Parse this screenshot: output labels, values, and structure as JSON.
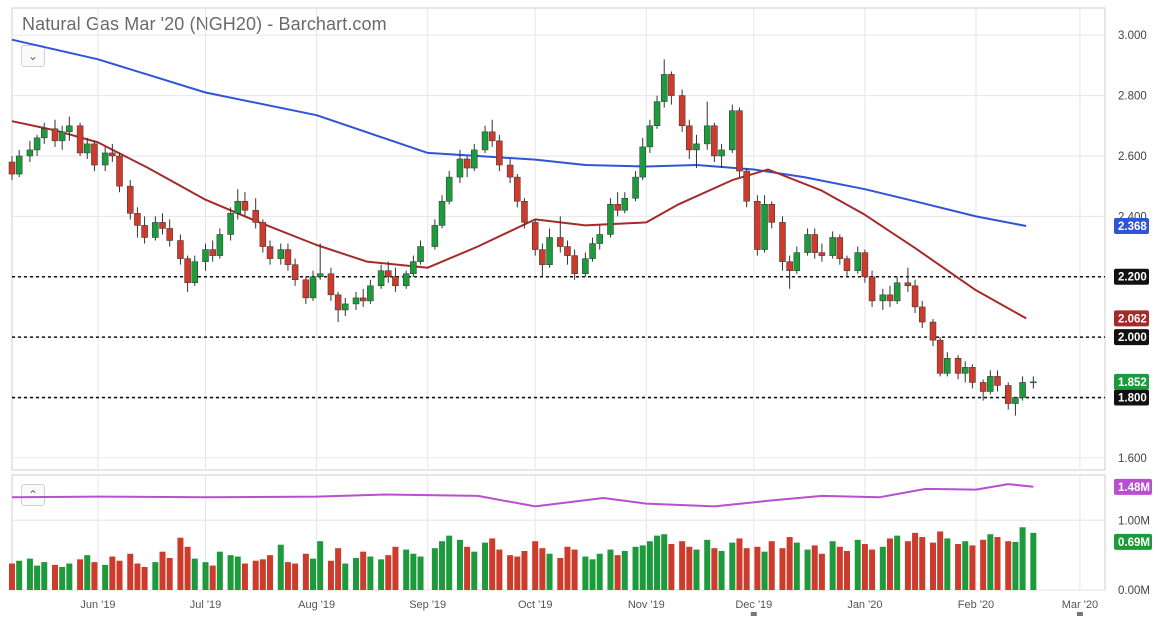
{
  "header": {
    "title": "Natural Gas Mar '20 (NGH20) - Barchart.com",
    "collapse_top_label": "⌄",
    "collapse_volume_label": "⌃"
  },
  "colors": {
    "up": "#1d9a3c",
    "down": "#cc3b2b",
    "ma_long": "#2f54d8",
    "ma_short": "#a52a2a",
    "volume_ma": "#b94fd0",
    "grid": "#e6e6e6",
    "neutral_bar": "#3450c0"
  },
  "chart_data": {
    "type": "candlestick",
    "x_axis": {
      "tick_labels": [
        "Jun '19",
        "Jul '19",
        "Aug '19",
        "Sep '19",
        "Oct '19",
        "Nov '19",
        "Dec '19",
        "Jan '20",
        "Feb '20",
        "Mar '20"
      ],
      "range": [
        "2019-05-08",
        "2020-03-08"
      ]
    },
    "price_axis": {
      "ylim": [
        1.56,
        3.09
      ],
      "tick_labels": [
        "3.000",
        "2.800",
        "2.600",
        "2.400",
        "2.200",
        "2.000",
        "1.800",
        "1.600"
      ],
      "tick_values": [
        3.0,
        2.8,
        2.6,
        2.4,
        2.2,
        2.0,
        1.8,
        1.6
      ]
    },
    "horizontal_lines": [
      {
        "value": 2.2,
        "label": "2.200"
      },
      {
        "value": 2.0,
        "label": "2.000"
      },
      {
        "value": 1.8,
        "label": "1.800"
      }
    ],
    "last_value_badges": [
      {
        "label": "2.368",
        "value": 2.368,
        "series": "ma_long"
      },
      {
        "label": "2.062",
        "value": 2.062,
        "series": "ma_short"
      },
      {
        "label": "1.852",
        "value": 1.852,
        "series": "price"
      }
    ],
    "ma_long": {
      "dates": [
        "2019-05-08",
        "2019-06-01",
        "2019-07-01",
        "2019-08-01",
        "2019-09-01",
        "2019-09-15",
        "2019-10-01",
        "2019-10-15",
        "2019-11-01",
        "2019-11-15",
        "2019-12-01",
        "2019-12-15",
        "2020-01-01",
        "2020-01-15",
        "2020-02-01",
        "2020-02-15"
      ],
      "values": [
        2.985,
        2.92,
        2.81,
        2.735,
        2.61,
        2.6,
        2.588,
        2.57,
        2.565,
        2.57,
        2.555,
        2.53,
        2.49,
        2.45,
        2.4,
        2.368
      ]
    },
    "ma_short": {
      "dates": [
        "2019-05-08",
        "2019-05-20",
        "2019-06-01",
        "2019-06-15",
        "2019-07-01",
        "2019-07-15",
        "2019-08-01",
        "2019-08-15",
        "2019-09-01",
        "2019-09-15",
        "2019-10-01",
        "2019-10-15",
        "2019-11-01",
        "2019-11-10",
        "2019-11-25",
        "2019-12-05",
        "2019-12-20",
        "2020-01-01",
        "2020-01-15",
        "2020-02-01",
        "2020-02-15"
      ],
      "values": [
        2.715,
        2.685,
        2.645,
        2.56,
        2.455,
        2.385,
        2.305,
        2.25,
        2.23,
        2.3,
        2.39,
        2.37,
        2.38,
        2.44,
        2.52,
        2.555,
        2.485,
        2.405,
        2.295,
        2.155,
        2.062
      ]
    },
    "ohlc": [
      [
        "2019-05-08",
        2.58,
        2.6,
        2.52,
        2.54
      ],
      [
        "2019-05-10",
        2.54,
        2.62,
        2.53,
        2.6
      ],
      [
        "2019-05-13",
        2.6,
        2.65,
        2.58,
        2.62
      ],
      [
        "2019-05-15",
        2.62,
        2.67,
        2.6,
        2.66
      ],
      [
        "2019-05-17",
        2.66,
        2.71,
        2.64,
        2.69
      ],
      [
        "2019-05-20",
        2.69,
        2.72,
        2.63,
        2.65
      ],
      [
        "2019-05-22",
        2.65,
        2.7,
        2.62,
        2.68
      ],
      [
        "2019-05-24",
        2.68,
        2.73,
        2.65,
        2.7
      ],
      [
        "2019-05-27",
        2.7,
        2.71,
        2.6,
        2.61
      ],
      [
        "2019-05-29",
        2.61,
        2.66,
        2.59,
        2.64
      ],
      [
        "2019-05-31",
        2.64,
        2.65,
        2.55,
        2.57
      ],
      [
        "2019-06-03",
        2.57,
        2.63,
        2.55,
        2.61
      ],
      [
        "2019-06-05",
        2.61,
        2.64,
        2.58,
        2.6
      ],
      [
        "2019-06-07",
        2.6,
        2.61,
        2.48,
        2.5
      ],
      [
        "2019-06-10",
        2.5,
        2.52,
        2.39,
        2.41
      ],
      [
        "2019-06-12",
        2.41,
        2.43,
        2.33,
        2.37
      ],
      [
        "2019-06-14",
        2.37,
        2.4,
        2.31,
        2.33
      ],
      [
        "2019-06-17",
        2.33,
        2.4,
        2.32,
        2.38
      ],
      [
        "2019-06-19",
        2.38,
        2.41,
        2.34,
        2.36
      ],
      [
        "2019-06-21",
        2.36,
        2.39,
        2.3,
        2.32
      ],
      [
        "2019-06-24",
        2.32,
        2.34,
        2.24,
        2.26
      ],
      [
        "2019-06-26",
        2.26,
        2.27,
        2.15,
        2.18
      ],
      [
        "2019-06-28",
        2.18,
        2.27,
        2.17,
        2.25
      ],
      [
        "2019-07-01",
        2.25,
        2.31,
        2.22,
        2.29
      ],
      [
        "2019-07-03",
        2.29,
        2.32,
        2.25,
        2.27
      ],
      [
        "2019-07-05",
        2.27,
        2.36,
        2.26,
        2.34
      ],
      [
        "2019-07-08",
        2.34,
        2.43,
        2.32,
        2.41
      ],
      [
        "2019-07-10",
        2.41,
        2.49,
        2.39,
        2.45
      ],
      [
        "2019-07-12",
        2.45,
        2.48,
        2.4,
        2.42
      ],
      [
        "2019-07-15",
        2.42,
        2.46,
        2.36,
        2.38
      ],
      [
        "2019-07-17",
        2.38,
        2.39,
        2.28,
        2.3
      ],
      [
        "2019-07-19",
        2.3,
        2.32,
        2.24,
        2.26
      ],
      [
        "2019-07-22",
        2.26,
        2.31,
        2.24,
        2.29
      ],
      [
        "2019-07-24",
        2.29,
        2.31,
        2.22,
        2.24
      ],
      [
        "2019-07-26",
        2.24,
        2.26,
        2.17,
        2.19
      ],
      [
        "2019-07-29",
        2.19,
        2.2,
        2.11,
        2.13
      ],
      [
        "2019-07-31",
        2.13,
        2.22,
        2.12,
        2.2
      ],
      [
        "2019-08-02",
        2.2,
        2.31,
        2.19,
        2.21
      ],
      [
        "2019-08-05",
        2.21,
        2.23,
        2.12,
        2.14
      ],
      [
        "2019-08-07",
        2.14,
        2.15,
        2.05,
        2.09
      ],
      [
        "2019-08-09",
        2.09,
        2.13,
        2.07,
        2.11
      ],
      [
        "2019-08-12",
        2.11,
        2.15,
        2.09,
        2.13
      ],
      [
        "2019-08-14",
        2.13,
        2.16,
        2.1,
        2.12
      ],
      [
        "2019-08-16",
        2.12,
        2.19,
        2.11,
        2.17
      ],
      [
        "2019-08-19",
        2.17,
        2.24,
        2.16,
        2.22
      ],
      [
        "2019-08-21",
        2.22,
        2.25,
        2.18,
        2.2
      ],
      [
        "2019-08-23",
        2.2,
        2.23,
        2.15,
        2.17
      ],
      [
        "2019-08-26",
        2.17,
        2.22,
        2.16,
        2.21
      ],
      [
        "2019-08-28",
        2.21,
        2.27,
        2.2,
        2.25
      ],
      [
        "2019-08-30",
        2.25,
        2.32,
        2.24,
        2.3
      ],
      [
        "2019-09-03",
        2.3,
        2.39,
        2.29,
        2.37
      ],
      [
        "2019-09-05",
        2.37,
        2.47,
        2.36,
        2.45
      ],
      [
        "2019-09-07",
        2.45,
        2.55,
        2.44,
        2.53
      ],
      [
        "2019-09-10",
        2.53,
        2.62,
        2.51,
        2.59
      ],
      [
        "2019-09-12",
        2.59,
        2.6,
        2.53,
        2.56
      ],
      [
        "2019-09-14",
        2.56,
        2.64,
        2.55,
        2.62
      ],
      [
        "2019-09-17",
        2.62,
        2.7,
        2.61,
        2.68
      ],
      [
        "2019-09-19",
        2.68,
        2.72,
        2.63,
        2.65
      ],
      [
        "2019-09-21",
        2.65,
        2.67,
        2.55,
        2.57
      ],
      [
        "2019-09-24",
        2.57,
        2.59,
        2.51,
        2.53
      ],
      [
        "2019-09-26",
        2.53,
        2.54,
        2.43,
        2.45
      ],
      [
        "2019-09-28",
        2.45,
        2.46,
        2.36,
        2.38
      ],
      [
        "2019-10-01",
        2.38,
        2.39,
        2.27,
        2.29
      ],
      [
        "2019-10-03",
        2.29,
        2.31,
        2.2,
        2.24
      ],
      [
        "2019-10-05",
        2.24,
        2.36,
        2.23,
        2.33
      ],
      [
        "2019-10-08",
        2.33,
        2.4,
        2.28,
        2.3
      ],
      [
        "2019-10-10",
        2.3,
        2.32,
        2.24,
        2.27
      ],
      [
        "2019-10-12",
        2.27,
        2.29,
        2.19,
        2.21
      ],
      [
        "2019-10-15",
        2.21,
        2.28,
        2.2,
        2.26
      ],
      [
        "2019-10-17",
        2.26,
        2.33,
        2.25,
        2.31
      ],
      [
        "2019-10-19",
        2.31,
        2.37,
        2.29,
        2.34
      ],
      [
        "2019-10-22",
        2.34,
        2.46,
        2.33,
        2.44
      ],
      [
        "2019-10-24",
        2.44,
        2.48,
        2.4,
        2.42
      ],
      [
        "2019-10-26",
        2.42,
        2.48,
        2.41,
        2.46
      ],
      [
        "2019-10-29",
        2.46,
        2.55,
        2.45,
        2.53
      ],
      [
        "2019-10-31",
        2.53,
        2.66,
        2.52,
        2.63
      ],
      [
        "2019-11-02",
        2.63,
        2.72,
        2.61,
        2.7
      ],
      [
        "2019-11-04",
        2.7,
        2.8,
        2.69,
        2.78
      ],
      [
        "2019-11-06",
        2.78,
        2.92,
        2.76,
        2.87
      ],
      [
        "2019-11-08",
        2.87,
        2.88,
        2.77,
        2.8
      ],
      [
        "2019-11-11",
        2.8,
        2.82,
        2.68,
        2.7
      ],
      [
        "2019-11-13",
        2.7,
        2.72,
        2.59,
        2.62
      ],
      [
        "2019-11-15",
        2.62,
        2.67,
        2.56,
        2.64
      ],
      [
        "2019-11-18",
        2.64,
        2.78,
        2.62,
        2.7
      ],
      [
        "2019-11-20",
        2.7,
        2.71,
        2.58,
        2.6
      ],
      [
        "2019-11-22",
        2.6,
        2.64,
        2.56,
        2.62
      ],
      [
        "2019-11-25",
        2.62,
        2.77,
        2.61,
        2.75
      ],
      [
        "2019-11-27",
        2.75,
        2.76,
        2.53,
        2.55
      ],
      [
        "2019-11-29",
        2.55,
        2.56,
        2.43,
        2.45
      ],
      [
        "2019-12-02",
        2.45,
        2.47,
        2.27,
        2.29
      ],
      [
        "2019-12-04",
        2.29,
        2.47,
        2.28,
        2.44
      ],
      [
        "2019-12-06",
        2.44,
        2.45,
        2.36,
        2.38
      ],
      [
        "2019-12-09",
        2.38,
        2.4,
        2.22,
        2.25
      ],
      [
        "2019-12-11",
        2.25,
        2.27,
        2.16,
        2.22
      ],
      [
        "2019-12-13",
        2.22,
        2.3,
        2.21,
        2.28
      ],
      [
        "2019-12-16",
        2.28,
        2.36,
        2.27,
        2.34
      ],
      [
        "2019-12-18",
        2.34,
        2.36,
        2.26,
        2.28
      ],
      [
        "2019-12-20",
        2.28,
        2.31,
        2.25,
        2.27
      ],
      [
        "2019-12-23",
        2.27,
        2.35,
        2.26,
        2.33
      ],
      [
        "2019-12-25",
        2.33,
        2.34,
        2.24,
        2.26
      ],
      [
        "2019-12-27",
        2.26,
        2.27,
        2.2,
        2.22
      ],
      [
        "2019-12-30",
        2.22,
        2.3,
        2.21,
        2.28
      ],
      [
        "2020-01-01",
        2.28,
        2.29,
        2.18,
        2.2
      ],
      [
        "2020-01-03",
        2.2,
        2.22,
        2.1,
        2.12
      ],
      [
        "2020-01-06",
        2.12,
        2.16,
        2.09,
        2.14
      ],
      [
        "2020-01-08",
        2.14,
        2.17,
        2.1,
        2.12
      ],
      [
        "2020-01-10",
        2.12,
        2.2,
        2.11,
        2.18
      ],
      [
        "2020-01-13",
        2.18,
        2.23,
        2.15,
        2.17
      ],
      [
        "2020-01-15",
        2.17,
        2.19,
        2.08,
        2.1
      ],
      [
        "2020-01-17",
        2.1,
        2.12,
        2.03,
        2.05
      ],
      [
        "2020-01-20",
        2.05,
        2.06,
        1.97,
        1.99
      ],
      [
        "2020-01-22",
        1.99,
        2.0,
        1.87,
        1.88
      ],
      [
        "2020-01-24",
        1.88,
        1.95,
        1.87,
        1.93
      ],
      [
        "2020-01-27",
        1.93,
        1.94,
        1.86,
        1.88
      ],
      [
        "2020-01-29",
        1.88,
        1.92,
        1.85,
        1.9
      ],
      [
        "2020-01-31",
        1.9,
        1.91,
        1.83,
        1.85
      ],
      [
        "2020-02-03",
        1.85,
        1.86,
        1.79,
        1.82
      ],
      [
        "2020-02-05",
        1.82,
        1.89,
        1.81,
        1.87
      ],
      [
        "2020-02-07",
        1.87,
        1.89,
        1.82,
        1.84
      ],
      [
        "2020-02-10",
        1.84,
        1.85,
        1.76,
        1.78
      ],
      [
        "2020-02-12",
        1.78,
        1.8,
        1.74,
        1.8
      ],
      [
        "2020-02-14",
        1.8,
        1.87,
        1.79,
        1.85
      ],
      [
        "2020-02-17",
        1.85,
        1.87,
        1.83,
        1.852
      ]
    ],
    "volume_axis": {
      "tick_labels": [
        "1.00M",
        "0.00M"
      ],
      "tick_values": [
        1.0,
        0.0
      ],
      "ylim": [
        0,
        1.65
      ]
    },
    "volume_badges": [
      {
        "label": "1.48M",
        "value": 1.48,
        "series": "volume_ma"
      },
      {
        "label": "0.69M",
        "value": 0.69,
        "series": "volume"
      }
    ],
    "volume_ma": {
      "dates": [
        "2019-05-08",
        "2019-06-01",
        "2019-07-01",
        "2019-08-01",
        "2019-08-20",
        "2019-09-15",
        "2019-10-01",
        "2019-10-20",
        "2019-11-01",
        "2019-11-20",
        "2019-12-05",
        "2019-12-20",
        "2020-01-05",
        "2020-01-18",
        "2020-02-01",
        "2020-02-10",
        "2020-02-17"
      ],
      "values": [
        1.33,
        1.34,
        1.33,
        1.34,
        1.37,
        1.35,
        1.2,
        1.32,
        1.24,
        1.2,
        1.28,
        1.35,
        1.33,
        1.45,
        1.44,
        1.52,
        1.48
      ]
    },
    "volume": [
      0.38,
      0.42,
      0.45,
      0.35,
      0.4,
      0.36,
      0.33,
      0.38,
      0.44,
      0.5,
      0.4,
      0.36,
      0.48,
      0.42,
      0.52,
      0.38,
      0.33,
      0.4,
      0.55,
      0.46,
      0.75,
      0.62,
      0.45,
      0.4,
      0.35,
      0.55,
      0.5,
      0.48,
      0.38,
      0.42,
      0.44,
      0.5,
      0.65,
      0.4,
      0.38,
      0.52,
      0.45,
      0.7,
      0.42,
      0.6,
      0.38,
      0.46,
      0.55,
      0.48,
      0.44,
      0.5,
      0.62,
      0.58,
      0.52,
      0.48,
      0.6,
      0.7,
      0.78,
      0.72,
      0.62,
      0.55,
      0.68,
      0.74,
      0.58,
      0.5,
      0.48,
      0.56,
      0.7,
      0.6,
      0.52,
      0.46,
      0.62,
      0.58,
      0.48,
      0.44,
      0.52,
      0.58,
      0.5,
      0.56,
      0.62,
      0.64,
      0.7,
      0.78,
      0.8,
      0.66,
      0.7,
      0.62,
      0.58,
      0.72,
      0.6,
      0.56,
      0.68,
      0.74,
      0.6,
      0.62,
      0.55,
      0.7,
      0.6,
      0.76,
      0.68,
      0.58,
      0.64,
      0.52,
      0.7,
      0.62,
      0.56,
      0.72,
      0.66,
      0.58,
      0.62,
      0.74,
      0.78,
      0.7,
      0.82,
      0.76,
      0.68,
      0.84,
      0.74,
      0.66,
      0.7,
      0.64,
      0.72,
      0.8,
      0.76,
      0.7,
      0.69,
      0.9,
      0.82,
      0.69
    ]
  }
}
